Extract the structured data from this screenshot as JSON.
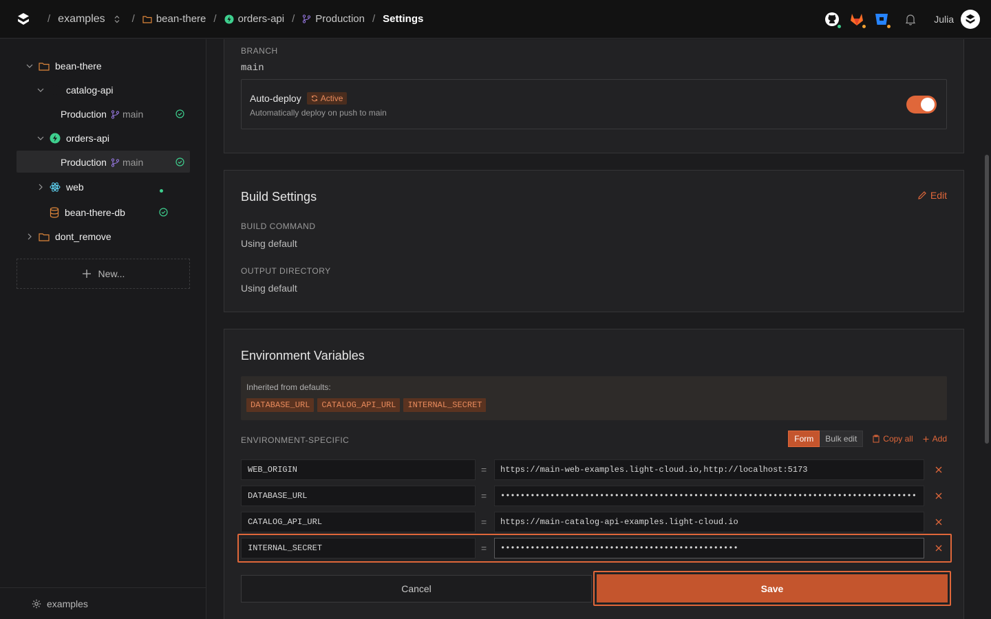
{
  "breadcrumb": {
    "org": "examples",
    "project": "bean-there",
    "service": "orders-api",
    "environment": "Production",
    "page": "Settings"
  },
  "topbar": {
    "user": "Julia",
    "icons": [
      "github-icon",
      "gitlab-icon",
      "bitbucket-icon",
      "bell-icon"
    ]
  },
  "sidebar": {
    "project": "bean-there",
    "items": [
      {
        "label": "catalog-api",
        "env": "Production",
        "branch": "main"
      },
      {
        "label": "orders-api",
        "env": "Production",
        "branch": "main"
      },
      {
        "label": "web"
      },
      {
        "label": "bean-there-db"
      },
      {
        "label": "dont_remove"
      }
    ],
    "new_label": "New...",
    "footer": "examples"
  },
  "branch_section": {
    "label": "BRANCH",
    "value": "main",
    "autodeploy_title": "Auto-deploy",
    "autodeploy_badge": "Active",
    "autodeploy_desc": "Automatically deploy on push to main",
    "autodeploy_on": true
  },
  "build": {
    "title": "Build Settings",
    "edit": "Edit",
    "cmd_label": "BUILD COMMAND",
    "cmd_value": "Using default",
    "out_label": "OUTPUT DIRECTORY",
    "out_value": "Using default"
  },
  "env": {
    "title": "Environment Variables",
    "inherited_label": "Inherited from defaults:",
    "inherited": [
      "DATABASE_URL",
      "CATALOG_API_URL",
      "INTERNAL_SECRET"
    ],
    "specific_label": "ENVIRONMENT-SPECIFIC",
    "mode_form": "Form",
    "mode_bulk": "Bulk edit",
    "copy_all": "Copy all",
    "add": "Add",
    "rows": [
      {
        "key": "WEB_ORIGIN",
        "value": "https://main-web-examples.light-cloud.io,http://localhost:5173"
      },
      {
        "key": "DATABASE_URL",
        "value": "••••••••••••••••••••••••••••••••••••••••••••••••••••••••••••••••••••••••••••••••••••"
      },
      {
        "key": "CATALOG_API_URL",
        "value": "https://main-catalog-api-examples.light-cloud.io"
      },
      {
        "key": "INTERNAL_SECRET",
        "value": "••••••••••••••••••••••••••••••••••••••••••••••••"
      }
    ],
    "cancel": "Cancel",
    "save": "Save"
  },
  "colors": {
    "accent": "#e0673a",
    "success": "#3ecf8e",
    "bg": "#1c1c1e"
  }
}
